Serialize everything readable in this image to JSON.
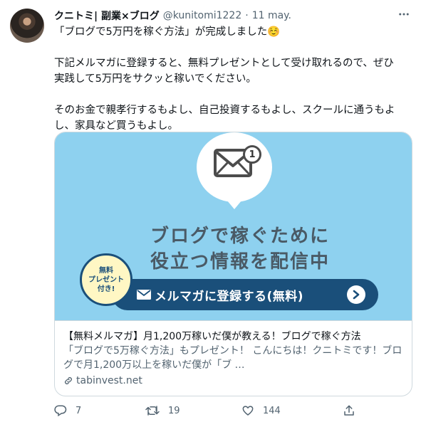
{
  "tweet": {
    "author_name": "クニトミ| 副業×ブログ",
    "handle": "@kunitomi1222",
    "separator": "·",
    "date": "11 may.",
    "lines": [
      "「ブログで5万円を稼ぐ方法」が完成しました☺️",
      "",
      "下記メルマガに登録すると、無料プレゼントとして受け取れるので、ぜひ",
      "実践して5万円をサクッと稼いでください。",
      "",
      "そのお金で親孝行するもよし、自己投資するもよし、スクールに通うもよ",
      "し、家具など買うもよし。"
    ]
  },
  "card": {
    "image": {
      "notification_count": "1",
      "headline_line1": "ブログで稼ぐために",
      "headline_line2": "役立つ情報を配信中",
      "badge_line1": "無料",
      "badge_line2": "プレゼント",
      "badge_line3": "付き!",
      "cta_label": "メルマガに登録する(無料)"
    },
    "title": "【無料メルマガ】月1,200万稼いだ僕が教える！ブログで稼ぐ方法",
    "description": "「ブログで5万稼ぐ方法」もプレゼント！ こんにちは！クニトミです！ブログで月1,200万以上を稼いだ僕が「ブ …",
    "domain": "tabinvest.net"
  },
  "actions": {
    "replies": "7",
    "retweets": "19",
    "likes": "144"
  },
  "icons": [
    "more-icon",
    "reply-icon",
    "retweet-icon",
    "like-icon",
    "share-icon",
    "link-icon",
    "envelope-icon",
    "arrow-right-icon"
  ],
  "colors": {
    "card_image_bg": "#8ed1ef",
    "cta_bg": "#1a4f7a",
    "text_secondary": "#536471"
  }
}
